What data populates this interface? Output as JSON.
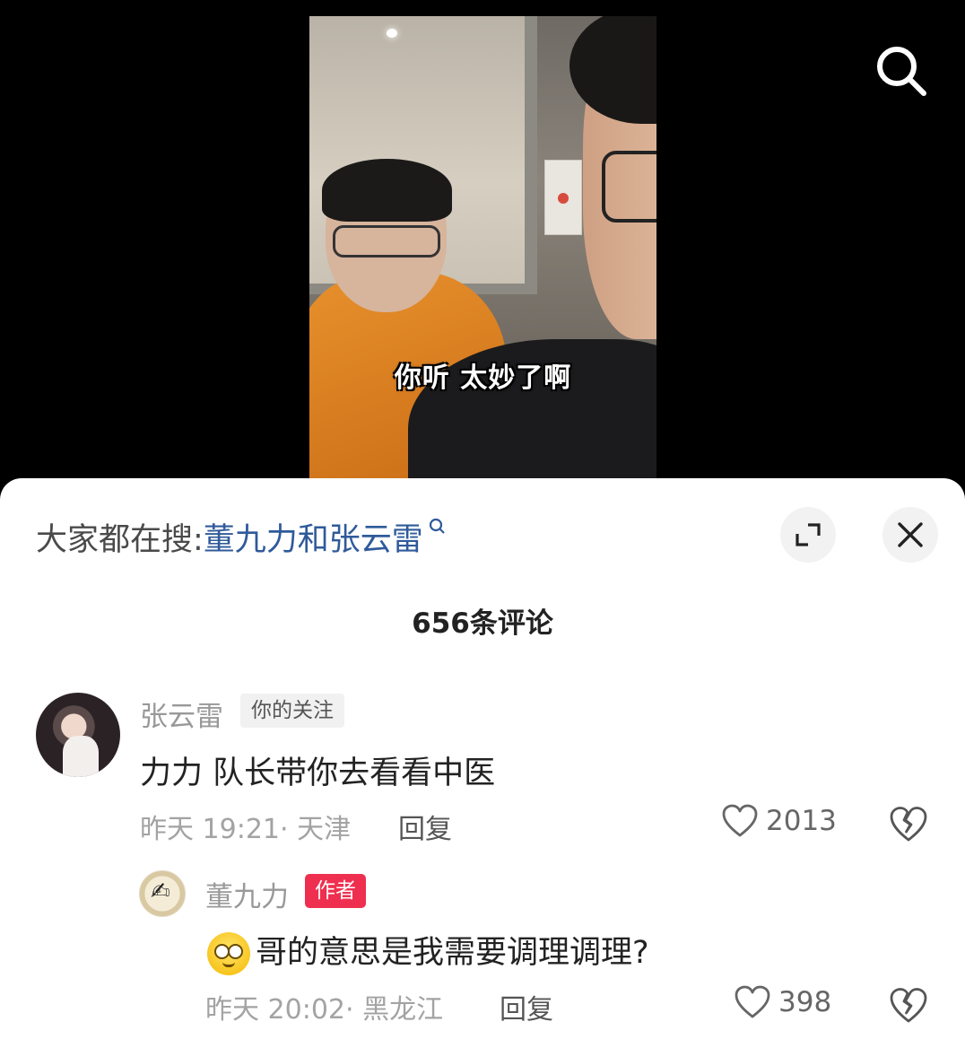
{
  "video": {
    "subtitle": "你听 太妙了啊"
  },
  "sheet": {
    "search_hint_prefix": "大家都在搜:",
    "search_hint_query": "董九力和张云雷",
    "search_hint_icon": "magnifier-small-icon",
    "comment_count": "656条评论"
  },
  "comments": [
    {
      "username": "张云雷",
      "tag": "你的关注",
      "text": "力力 队长带你去看看中医",
      "time_location": "昨天 19:21· 天津",
      "reply_label": "回复",
      "likes": "2013",
      "reply": {
        "username": "董九力",
        "tag": "作者",
        "tag_color": "#ef2f4f",
        "text": "哥的意思是我需要调理调理?",
        "emoji": "dizzy-face-emoji",
        "time_location": "昨天 20:02· 黑龙江",
        "reply_label": "回复",
        "likes": "398"
      }
    }
  ],
  "colors": {
    "accent_link": "#2f5a9a",
    "author_badge": "#ef2f4f"
  }
}
